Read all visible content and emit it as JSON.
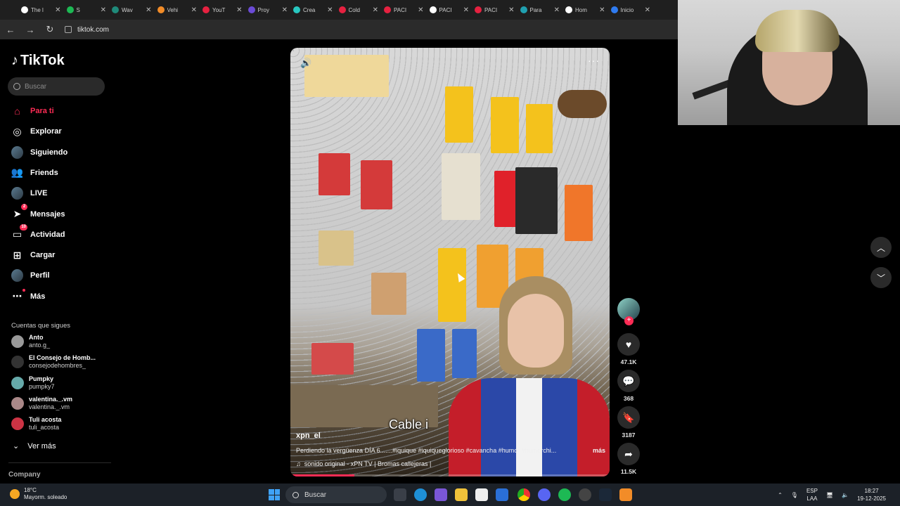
{
  "browser": {
    "tabs": [
      {
        "label": "The l",
        "color": "#ffffff"
      },
      {
        "label": "S",
        "color": "#1db954"
      },
      {
        "label": "Wav",
        "color": "#1f8a7a"
      },
      {
        "label": "Vehi",
        "color": "#f28c28"
      },
      {
        "label": "YouT",
        "color": "#e62140"
      },
      {
        "label": "Proy",
        "color": "#6b4bd6"
      },
      {
        "label": "Crea",
        "color": "#28c7c0"
      },
      {
        "label": "Cold",
        "color": "#e62140"
      },
      {
        "label": "PACI",
        "color": "#e62140"
      },
      {
        "label": "PACI",
        "color": "#ffffff"
      },
      {
        "label": "PACI",
        "color": "#e62140"
      },
      {
        "label": "Para",
        "color": "#20a0b0"
      },
      {
        "label": "Hom",
        "color": "#ffffff"
      },
      {
        "label": "Inicio",
        "color": "#2f7bf0"
      }
    ],
    "url": "tiktok.com"
  },
  "sidebar": {
    "brand": "TikTok",
    "search_placeholder": "Buscar",
    "nav": [
      {
        "label": "Para ti",
        "icon": "home-icon",
        "active": true
      },
      {
        "label": "Explorar",
        "icon": "compass-icon"
      },
      {
        "label": "Siguiendo",
        "icon": "avatar-icon"
      },
      {
        "label": "Friends",
        "icon": "friends-icon"
      },
      {
        "label": "LIVE",
        "icon": "live-icon"
      },
      {
        "label": "Mensajes",
        "icon": "send-icon",
        "badge": "2"
      },
      {
        "label": "Actividad",
        "icon": "inbox-icon",
        "badge": "10"
      },
      {
        "label": "Cargar",
        "icon": "upload-icon"
      },
      {
        "label": "Perfil",
        "icon": "profile-icon"
      },
      {
        "label": "Más",
        "icon": "more-icon"
      }
    ],
    "following_title": "Cuentas que sigues",
    "following": [
      {
        "name": "Anto",
        "handle": "anto.g_"
      },
      {
        "name": "El Consejo de Homb...",
        "handle": "consejodehombres_"
      },
      {
        "name": "Pumpky",
        "handle": "pumpky7"
      },
      {
        "name": "valentina._.vm",
        "handle": "valentina._.vm"
      },
      {
        "name": "Tuli acosta",
        "handle": "tuli_acosta"
      }
    ],
    "see_more": "Ver más",
    "company": "Company"
  },
  "video": {
    "overlay_text": "Cable i",
    "username": "xpn_el",
    "description": "Perdiendo la vergüenza DÍA 6.......#iquique #iquiqueglorioso #cavancha #humor #humorchi...",
    "more": "más",
    "sound": "sonido original - xPN TV | Bromas callejeras |",
    "progress": 0.2
  },
  "actions": {
    "likes": "47.1K",
    "comments": "368",
    "saves": "3187",
    "shares": "11.5K"
  },
  "taskbar": {
    "temp": "18°C",
    "weather": "Mayorm. soleado",
    "search": "Buscar",
    "lang_top": "ESP",
    "lang_bottom": "LAA",
    "time": "18:27",
    "date": "19-12-2025"
  }
}
